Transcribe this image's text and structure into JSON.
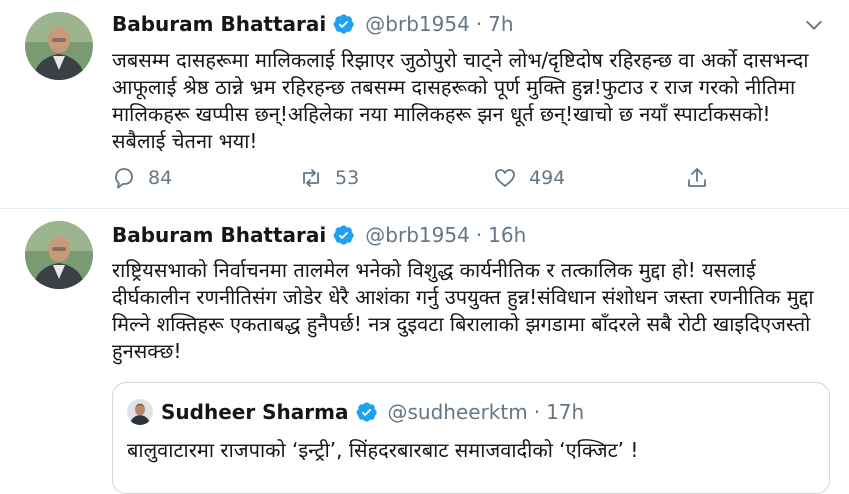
{
  "tweets": [
    {
      "author": "Baburam Bhattarai",
      "handle": "@brb1954",
      "separator": "·",
      "time": "7h",
      "text": "जबसम्म दासहरूमा मालिकलाई रिझाएर जुठोपुरो चाट्ने लोभ/दृष्टिदोष रहिरहन्छ वा अर्को दासभन्दा आफूलाई श्रेष्ठ ठान्ने भ्रम रहिरहन्छ तबसम्म दासहरूको पूर्ण मुक्ति हुन्न!फुटाउ र राज गरको नीतिमा मालिकहरू खप्पीस छन्!अहिलेका नया मालिकहरू झन धूर्त छन्!खाचो छ नयाँ स्पार्टाकसको!सबैलाई चेतना भया!",
      "replies": "84",
      "retweets": "53",
      "likes": "494"
    },
    {
      "author": "Baburam Bhattarai",
      "handle": "@brb1954",
      "separator": "·",
      "time": "16h",
      "text": "राष्ट्रियसभाको निर्वाचनमा तालमेल भनेको विशुद्ध कार्यनीतिक र तत्कालिक मुद्दा हो! यसलाई दीर्घकालीन रणनीतिसंग जोडेर धेरै आशंका गर्नु उपयुक्त हुन्न!संविधान संशोधन जस्ता रणनीतिक मुद्दा मिल्ने शक्तिहरू एकताबद्ध हुनैपर्छ! नत्र दुइवटा बिरालाको झगडामा बाँदरले सबै रोटी खाइदिएजस्तो हुनसक्छ!",
      "quote": {
        "author": "Sudheer Sharma",
        "handle": "@sudheerktm",
        "separator": "·",
        "time": "17h",
        "text": "बालुवाटारमा राजपाको ‘इन्ट्री’, सिंहदरबारबाट समाजवादीको ‘एक्जिट’ !"
      }
    }
  ],
  "colors": {
    "text": "#14171a",
    "muted": "#657786",
    "verified": "#1da1f2",
    "border": "#e6ecf0"
  }
}
